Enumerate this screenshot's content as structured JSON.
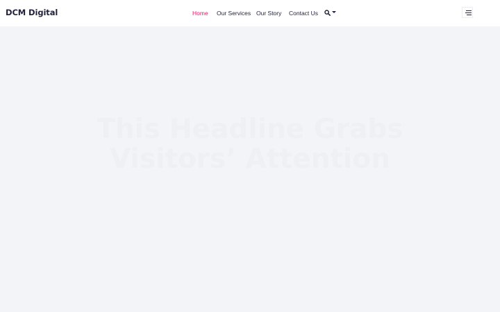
{
  "site": {
    "logo": "DCM Digital"
  },
  "nav": {
    "items": [
      {
        "label": "Home",
        "active": true
      },
      {
        "label": "Our Services",
        "active": false
      },
      {
        "label": "Our Story",
        "active": false
      },
      {
        "label": "Contact Us",
        "active": false
      }
    ],
    "search_icon": "search-icon",
    "menu_icon": "hamburger-menu-icon"
  },
  "hero": {
    "headline_line1": "This Headline Grabs",
    "headline_line2": "Visitors’ Attention"
  },
  "colors": {
    "accent": "#e7156d",
    "text": "#1f2239",
    "background": "#f3f4f8",
    "header": "#ffffff"
  }
}
